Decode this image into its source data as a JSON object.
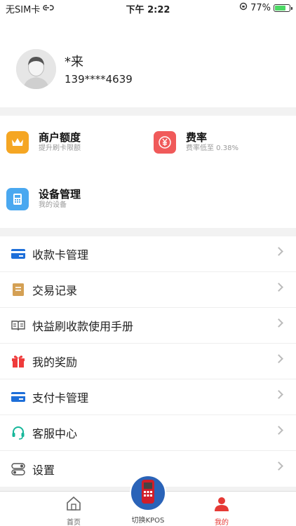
{
  "status_bar": {
    "carrier": "无SIM卡",
    "time": "下午 2:22",
    "battery": "77%",
    "battery_level": 0.77
  },
  "profile": {
    "name": "*来",
    "phone": "139****4639"
  },
  "services": [
    {
      "title": "商户额度",
      "subtitle": "提升刷卡限额",
      "icon": "crown-icon",
      "color": "#f5a623"
    },
    {
      "title": "费率",
      "subtitle": "费率低至 0.38%",
      "icon": "yen-icon",
      "color": "#f05a5a"
    },
    {
      "title": "设备管理",
      "subtitle": "我的设备",
      "icon": "device-icon",
      "color": "#4aa8f0"
    }
  ],
  "menu": [
    {
      "label": "收款卡管理",
      "icon": "card-icon"
    },
    {
      "label": "交易记录",
      "icon": "record-icon"
    },
    {
      "label": "快益刷收款使用手册",
      "icon": "book-icon"
    },
    {
      "label": "我的奖励",
      "icon": "gift-icon"
    },
    {
      "label": "支付卡管理",
      "icon": "pay-card-icon"
    },
    {
      "label": "客服中心",
      "icon": "headset-icon"
    },
    {
      "label": "设置",
      "icon": "settings-icon"
    }
  ],
  "tabbar": {
    "home": "首页",
    "switch": "切换KPOS",
    "mine": "我的",
    "active_color": "#e53935"
  }
}
